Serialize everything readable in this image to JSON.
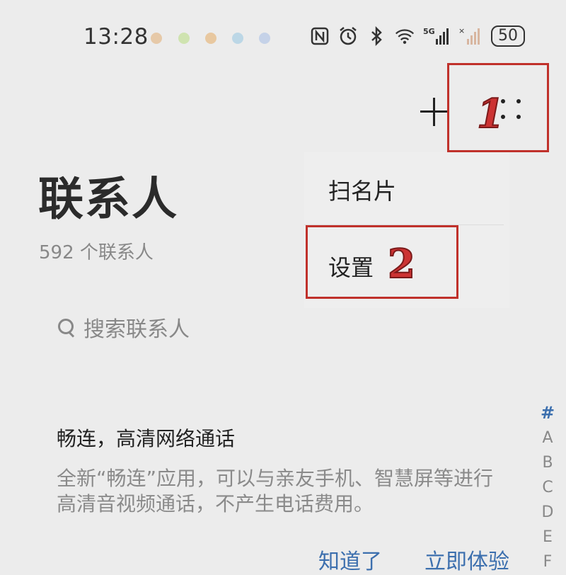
{
  "status_bar": {
    "time": "13:28",
    "battery": "50",
    "notification_dot_colors": [
      "#e6c9a8",
      "#cfe3b0",
      "#e8c8a0",
      "#bcd7e6",
      "#c5d2e8"
    ],
    "icons": [
      "nfc-icon",
      "alarm-icon",
      "bluetooth-icon",
      "wifi-icon",
      "signal-5g-icon",
      "signal-no-sim-icon"
    ]
  },
  "toolbar": {
    "add_icon": "plus-icon",
    "more_icon": "more-icon",
    "annotation_1": "1"
  },
  "header": {
    "title": "联系人",
    "count": "592 个联系人"
  },
  "search": {
    "placeholder": "搜索联系人"
  },
  "menu": {
    "items": [
      {
        "label": "扫名片"
      },
      {
        "label": "设置"
      }
    ],
    "annotation_2": "2"
  },
  "promo": {
    "title": "畅连，高清网络通话",
    "description": "全新“畅连”应用，可以与亲友手机、智慧屏等进行高清音视频通话，不产生电话费用。",
    "dismiss_label": "知道了",
    "try_label": "立即体验"
  },
  "index_bar": [
    "#",
    "A",
    "B",
    "C",
    "D",
    "E",
    "F"
  ],
  "colors": {
    "accent": "#3c6fae",
    "annotation": "#c0312b"
  }
}
